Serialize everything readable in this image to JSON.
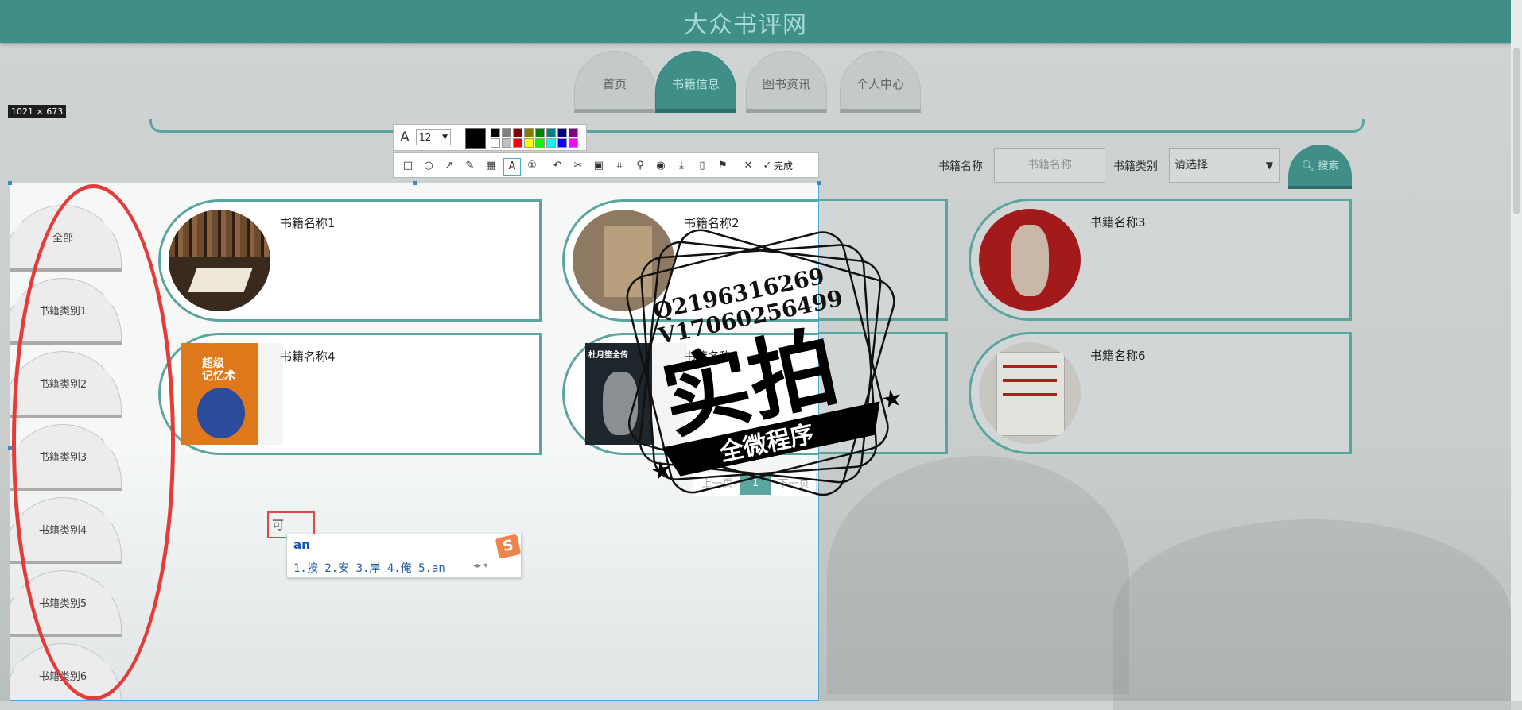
{
  "header": {
    "title": "大众书评网"
  },
  "nav": {
    "tabs": [
      {
        "label": "首页",
        "active": false
      },
      {
        "label": "书籍信息",
        "active": true
      },
      {
        "label": "图书资讯",
        "active": false
      },
      {
        "label": "个人中心",
        "active": false
      }
    ]
  },
  "search": {
    "name_label": "书籍名称",
    "name_placeholder": "书籍名称",
    "category_label": "书籍类别",
    "category_value": "请选择",
    "button_label": "搜索"
  },
  "capture": {
    "size_label": "1021 × 673",
    "font_size": "12",
    "done_label": "完成",
    "palette": [
      "#000000",
      "#808080",
      "#800000",
      "#808000",
      "#008000",
      "#008080",
      "#000080",
      "#800080",
      "#ffffff",
      "#c0c0c0",
      "#ff0000",
      "#ffff00",
      "#00ff00",
      "#00ffff",
      "#0000ff",
      "#ff00ff"
    ]
  },
  "categories": [
    "全部",
    "书籍类别1",
    "书籍类别2",
    "书籍类别3",
    "书籍类别4",
    "书籍类别5",
    "书籍类别6"
  ],
  "books": [
    {
      "title": "书籍名称1",
      "cover_color": "#4a3525"
    },
    {
      "title": "书籍名称2",
      "cover_color": "#8e7a62"
    },
    {
      "title": "书籍名称3",
      "cover_color": "#b81818"
    },
    {
      "title": "书籍名称4",
      "cover_color": "#d8761a",
      "cover_text": "超级\n记忆术"
    },
    {
      "title": "书籍名称5",
      "cover_color": "#222a30",
      "cover_text": "杜月笙全传"
    },
    {
      "title": "书籍名称6",
      "cover_color": "#e8e6e0"
    }
  ],
  "pagination": {
    "prev": "上一页",
    "current": "1",
    "next": "下一页"
  },
  "watermark": {
    "line1": "Q2196316269",
    "line2": "V17060256499",
    "big": "实拍",
    "banner": "全微程序"
  },
  "ime": {
    "typed_char": "可",
    "input": "an",
    "candidates": "1.按  2.安  3.岸  4.俺  5.an"
  }
}
